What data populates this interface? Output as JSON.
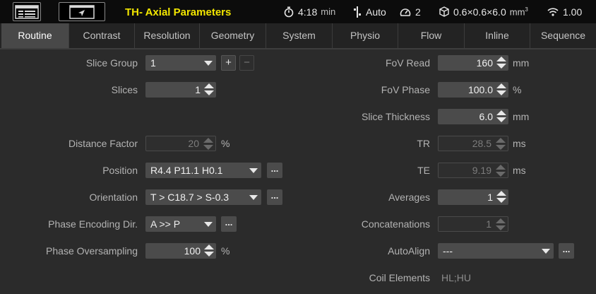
{
  "topbar": {
    "title": "TH- Axial Parameters",
    "time": "4:18",
    "time_unit": "min",
    "coil_mode": "Auto",
    "gauge_value": "2",
    "voxel": "0.6×0.6×6.0",
    "voxel_unit": "mm",
    "voxel_unit_sup": "3",
    "signal_value": "1.00",
    "title_color": "#f2e600"
  },
  "tabs": [
    {
      "label": "Routine",
      "active": true
    },
    {
      "label": "Contrast"
    },
    {
      "label": "Resolution"
    },
    {
      "label": "Geometry"
    },
    {
      "label": "System"
    },
    {
      "label": "Physio"
    },
    {
      "label": "Flow"
    },
    {
      "label": "Inline"
    },
    {
      "label": "Sequence"
    }
  ],
  "left": {
    "slice_group": {
      "label": "Slice Group",
      "value": "1",
      "plus": "+",
      "minus": "−"
    },
    "slices": {
      "label": "Slices",
      "value": "1"
    },
    "distance_factor": {
      "label": "Distance Factor",
      "value": "20",
      "unit": "%"
    },
    "position": {
      "label": "Position",
      "value": "R4.4 P11.1 H0.1",
      "more": "..."
    },
    "orientation": {
      "label": "Orientation",
      "value": "T > C18.7 > S-0.3",
      "more": "..."
    },
    "phase_enc_dir": {
      "label": "Phase Encoding Dir.",
      "value": "A >> P",
      "more": "..."
    },
    "phase_oversampling": {
      "label": "Phase Oversampling",
      "value": "100",
      "unit": "%"
    }
  },
  "right": {
    "fov_read": {
      "label": "FoV Read",
      "value": "160",
      "unit": "mm"
    },
    "fov_phase": {
      "label": "FoV Phase",
      "value": "100.0",
      "unit": "%"
    },
    "slice_thickness": {
      "label": "Slice Thickness",
      "value": "6.0",
      "unit": "mm"
    },
    "tr": {
      "label": "TR",
      "value": "28.5",
      "unit": "ms"
    },
    "te": {
      "label": "TE",
      "value": "9.19",
      "unit": "ms"
    },
    "averages": {
      "label": "Averages",
      "value": "1"
    },
    "concatenations": {
      "label": "Concatenations",
      "value": "1"
    },
    "autoalign": {
      "label": "AutoAlign",
      "value": "---",
      "more": "..."
    },
    "coil_elements": {
      "label": "Coil Elements",
      "value": "HL;HU"
    }
  }
}
